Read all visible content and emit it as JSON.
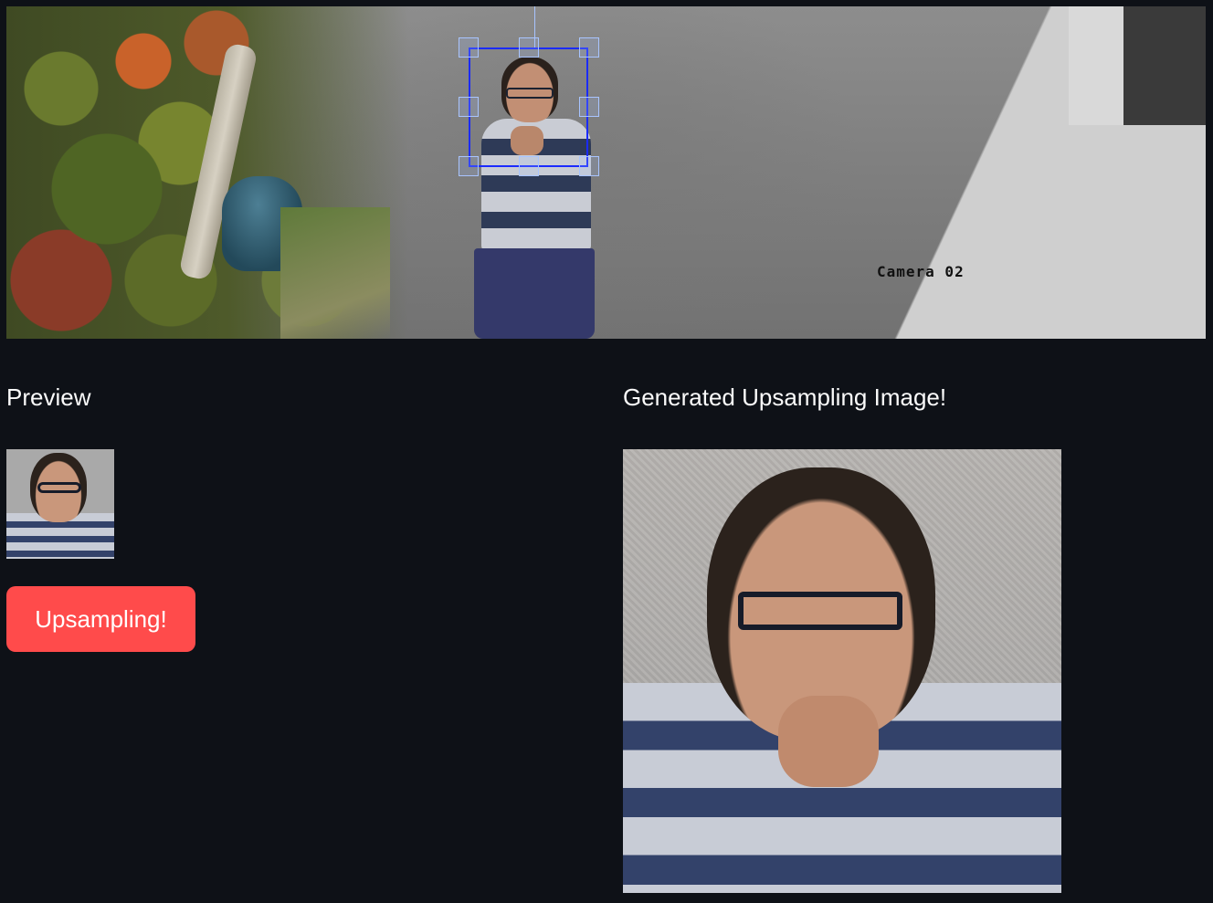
{
  "camera": {
    "overlay_label": "Camera 02"
  },
  "preview": {
    "title": "Preview"
  },
  "actions": {
    "upsample_label": "Upsampling!",
    "accent": "#ff4b4b"
  },
  "generated": {
    "title": "Generated Upsampling Image!"
  },
  "theme": {
    "background": "#0e1117",
    "crop_border": "#1b2bff",
    "crop_handle": "#a8c4ff"
  },
  "icons": [
    "crop-handle-icon"
  ]
}
